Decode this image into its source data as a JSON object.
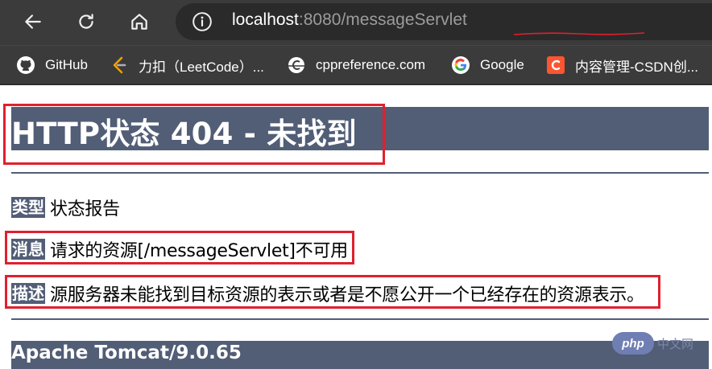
{
  "browser": {
    "url_host": "localhost",
    "url_port": ":8080",
    "url_path": "/messageServlet",
    "bookmarks": [
      {
        "label": "GitHub",
        "icon": "github-icon"
      },
      {
        "label": "力扣（LeetCode）...",
        "icon": "leetcode-icon"
      },
      {
        "label": "cppreference.com",
        "icon": "cppreference-icon"
      },
      {
        "label": "Google",
        "icon": "google-icon"
      },
      {
        "label": "内容管理-CSDN创...",
        "icon": "csdn-icon"
      }
    ]
  },
  "page": {
    "title": "HTTP状态 404 - 未找到",
    "type_label": "类型",
    "type_value": "状态报告",
    "message_label": "消息",
    "message_value": "请求的资源[/messageServlet]不可用",
    "description_label": "描述",
    "description_value": "源服务器未能找到目标资源的表示或者是不愿公开一个已经存在的资源表示。",
    "footer": "Apache Tomcat/9.0.65"
  },
  "watermark": {
    "badge": "php",
    "text": "中文网"
  },
  "colors": {
    "tomcat_band": "#525d76",
    "highlight_box": "#e0202e",
    "chrome_bg": "#3b3b3b"
  }
}
